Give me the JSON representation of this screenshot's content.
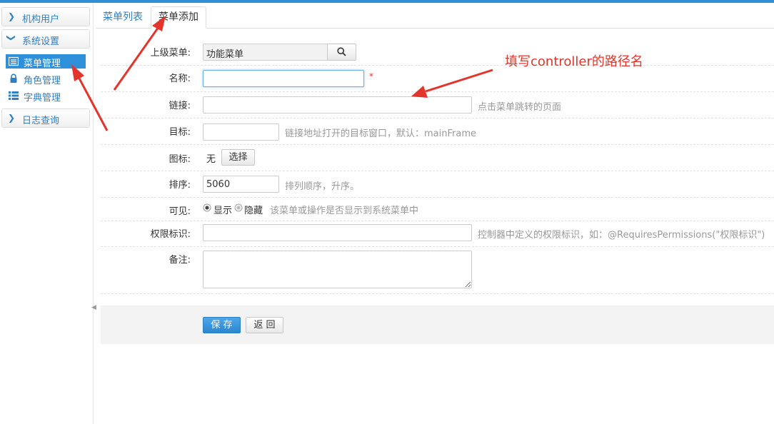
{
  "sidebar": {
    "groups": [
      {
        "label": "机构用户",
        "icon": "chevron-right-icon"
      },
      {
        "label": "系统设置",
        "icon": "chevron-down-icon"
      },
      {
        "label": "日志查询",
        "icon": "chevron-right-icon"
      }
    ],
    "items": [
      {
        "label": "菜单管理",
        "icon": "list-icon",
        "active": true
      },
      {
        "label": "角色管理",
        "icon": "lock-icon"
      },
      {
        "label": "字典管理",
        "icon": "bulleted-list-icon"
      }
    ]
  },
  "tabs": [
    {
      "label": "菜单列表"
    },
    {
      "label": "菜单添加",
      "active": true
    }
  ],
  "form": {
    "parent": {
      "label": "上级菜单:",
      "value": "功能菜单"
    },
    "name": {
      "label": "名称:",
      "value": "",
      "required_mark": "*"
    },
    "link": {
      "label": "链接:",
      "value": "",
      "help": "点击菜单跳转的页面"
    },
    "target": {
      "label": "目标:",
      "value": "",
      "help": "链接地址打开的目标窗口，默认：mainFrame"
    },
    "icon": {
      "label": "图标:",
      "value": "无",
      "button": "选择"
    },
    "sort": {
      "label": "排序:",
      "value": "5060",
      "help": "排列顺序，升序。"
    },
    "visible": {
      "label": "可见:",
      "option_show": "显示",
      "option_hide": "隐藏",
      "selected": "显示",
      "help": "该菜单或操作是否显示到系统菜单中"
    },
    "permission": {
      "label": "权限标识:",
      "value": "",
      "help": "控制器中定义的权限标识，如：@RequiresPermissions(\"权限标识\")"
    },
    "remarks": {
      "label": "备注:",
      "value": ""
    }
  },
  "actions": {
    "save": "保 存",
    "back": "返 回"
  },
  "annotation": {
    "text": "填写controller的路径名",
    "color": "#e3352b"
  },
  "colors": {
    "accent": "#2f8fd8",
    "link": "#2f7fc1"
  }
}
